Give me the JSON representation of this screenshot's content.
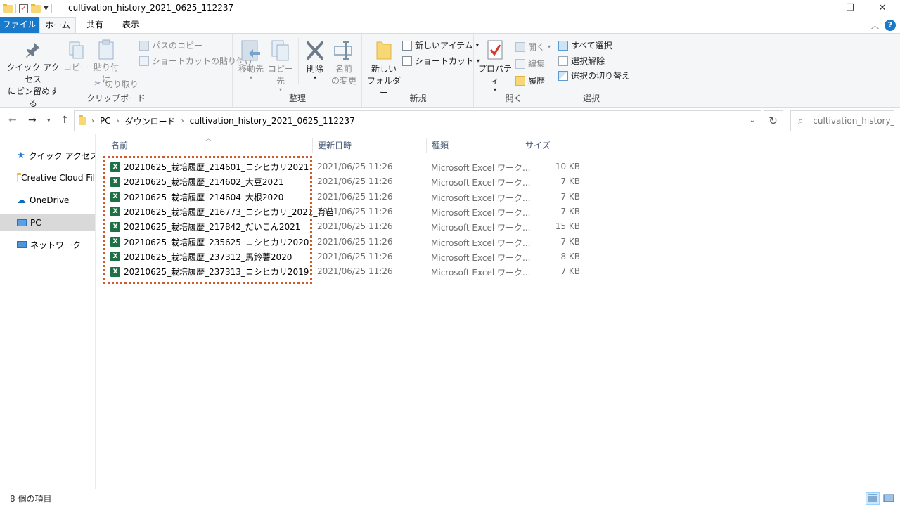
{
  "window": {
    "title": "cultivation_history_2021_0625_112237",
    "minimize": "—",
    "restore": "❐",
    "close": "✕"
  },
  "tabs": {
    "file": "ファイル",
    "home": "ホーム",
    "share": "共有",
    "view": "表示"
  },
  "ribbon": {
    "clipboard": {
      "label": "クリップボード",
      "pin_line1": "クイック アクセス",
      "pin_line2": "にピン留めする",
      "copy": "コピー",
      "paste": "貼り付け",
      "copy_path": "パスのコピー",
      "paste_shortcut": "ショートカットの貼り付け",
      "cut": "切り取り"
    },
    "organize": {
      "label": "整理",
      "move_to": "移動先",
      "copy_to": "コピー先",
      "delete": "削除",
      "rename_line1": "名前",
      "rename_line2": "の変更"
    },
    "new": {
      "label": "新規",
      "new_folder_line1": "新しい",
      "new_folder_line2": "フォルダー",
      "new_item": "新しいアイテム",
      "shortcut": "ショートカット"
    },
    "open": {
      "label": "開く",
      "properties": "プロパティ",
      "open": "開く",
      "edit": "編集",
      "history": "履歴"
    },
    "select": {
      "label": "選択",
      "select_all": "すべて選択",
      "select_none": "選択解除",
      "invert": "選択の切り替え"
    }
  },
  "address": {
    "crumbs": [
      "PC",
      "ダウンロード",
      "cultivation_history_2021_0625_112237"
    ],
    "search_placeholder": "cultivation_history_..."
  },
  "nav": {
    "quick_access": "クイック アクセス",
    "creative_cloud": "Creative Cloud Fil",
    "onedrive": "OneDrive",
    "pc": "PC",
    "network": "ネットワーク"
  },
  "columns": {
    "name": "名前",
    "modified": "更新日時",
    "type": "種類",
    "size": "サイズ"
  },
  "files": [
    {
      "name": "20210625_栽培履歴_214601_コシヒカリ2021",
      "date": "2021/06/25 11:26",
      "type": "Microsoft Excel ワーク...",
      "size": "10 KB"
    },
    {
      "name": "20210625_栽培履歴_214602_大豆2021",
      "date": "2021/06/25 11:26",
      "type": "Microsoft Excel ワーク...",
      "size": "7 KB"
    },
    {
      "name": "20210625_栽培履歴_214604_大根2020",
      "date": "2021/06/25 11:26",
      "type": "Microsoft Excel ワーク...",
      "size": "7 KB"
    },
    {
      "name": "20210625_栽培履歴_216773_コシヒカリ_2021_育苗",
      "date": "2021/06/25 11:26",
      "type": "Microsoft Excel ワーク...",
      "size": "7 KB"
    },
    {
      "name": "20210625_栽培履歴_217842_だいこん2021",
      "date": "2021/06/25 11:26",
      "type": "Microsoft Excel ワーク...",
      "size": "15 KB"
    },
    {
      "name": "20210625_栽培履歴_235625_コシヒカリ2020",
      "date": "2021/06/25 11:26",
      "type": "Microsoft Excel ワーク...",
      "size": "7 KB"
    },
    {
      "name": "20210625_栽培履歴_237312_馬鈴薯2020",
      "date": "2021/06/25 11:26",
      "type": "Microsoft Excel ワーク...",
      "size": "8 KB"
    },
    {
      "name": "20210625_栽培履歴_237313_コシヒカリ2019",
      "date": "2021/06/25 11:26",
      "type": "Microsoft Excel ワーク...",
      "size": "7 KB"
    }
  ],
  "status": {
    "count": "8 個の項目"
  },
  "colors": {
    "accent": "#1979ca",
    "highlight": "#d0592b",
    "excel": "#1e7145"
  }
}
